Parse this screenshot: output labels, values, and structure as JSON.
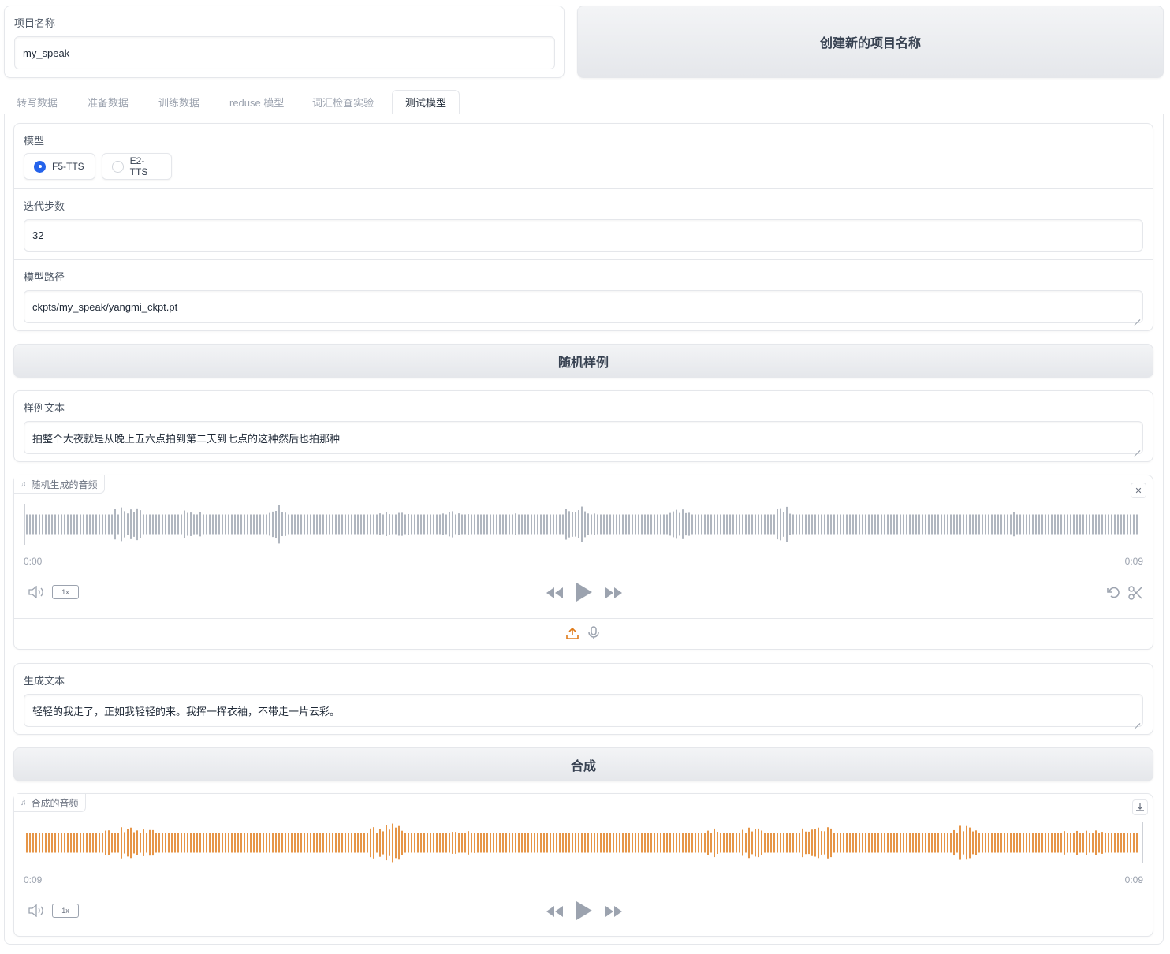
{
  "project": {
    "label": "项目名称",
    "value": "my_speak",
    "create_button": "创建新的项目名称"
  },
  "tabs": [
    {
      "label": "转写数据",
      "active": false
    },
    {
      "label": "准备数据",
      "active": false
    },
    {
      "label": "训练数据",
      "active": false
    },
    {
      "label": "reduse 模型",
      "active": false
    },
    {
      "label": "词汇检查实验",
      "active": false
    },
    {
      "label": "测试模型",
      "active": true
    }
  ],
  "model": {
    "label": "模型",
    "options": [
      {
        "label": "F5-TTS",
        "checked": true
      },
      {
        "label": "E2-TTS",
        "checked": false
      }
    ]
  },
  "steps": {
    "label": "迭代步数",
    "value": "32"
  },
  "model_path": {
    "label": "模型路径",
    "value": "ckpts/my_speak/yangmi_ckpt.pt"
  },
  "random_button": "随机样例",
  "sample_text": {
    "label": "样例文本",
    "value": "拍整个大夜就是从晚上五六点拍到第二天到七点的这种然后也拍那种"
  },
  "random_audio": {
    "label": "随机生成的音频",
    "time_start": "0:00",
    "time_end": "0:09",
    "speed": "1x",
    "waveform_color": "#9ca3af"
  },
  "gen_text": {
    "label": "生成文本",
    "value": "轻轻的我走了，正如我轻轻的来。我挥一挥衣袖，不带走一片云彩。"
  },
  "synth_button": "合成",
  "synth_audio": {
    "label": "合成的音频",
    "time_start": "0:09",
    "time_end": "0:09",
    "speed": "1x",
    "waveform_color": "#e07b1a"
  },
  "icons": {
    "music": "music-note-icon",
    "close": "close-icon",
    "download": "download-icon",
    "volume": "volume-icon",
    "rewind": "rewind-icon",
    "play": "play-icon",
    "forward": "fast-forward-icon",
    "undo": "undo-icon",
    "scissors": "scissors-icon",
    "upload": "upload-icon",
    "mic": "microphone-icon"
  }
}
